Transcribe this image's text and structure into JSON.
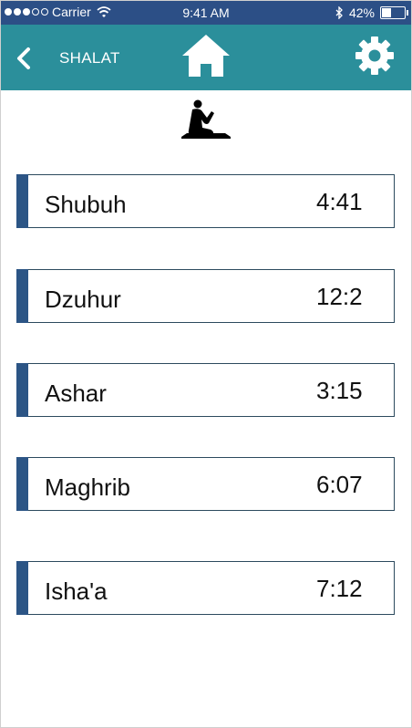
{
  "status": {
    "carrier": "Carrier",
    "time": "9:41 AM",
    "battery": "42%",
    "battery_level": 0.42
  },
  "nav": {
    "back_icon": "chevron-left-icon",
    "title": "SHALAT",
    "home_icon": "home-icon",
    "settings_icon": "gear-icon"
  },
  "header_icon": "praying-person-icon",
  "colors": {
    "status_bar": "#2c4f86",
    "nav_bar": "#2b8f9b",
    "row_accent": "#2c5585",
    "row_border": "#2c4a5e"
  },
  "prayers": [
    {
      "name": "Shubuh",
      "time": "4:41"
    },
    {
      "name": "Dzuhur",
      "time": "12:2"
    },
    {
      "name": "Ashar",
      "time": "3:15"
    },
    {
      "name": "Maghrib",
      "time": "6:07"
    },
    {
      "name": "Isha'a",
      "time": "7:12"
    }
  ]
}
